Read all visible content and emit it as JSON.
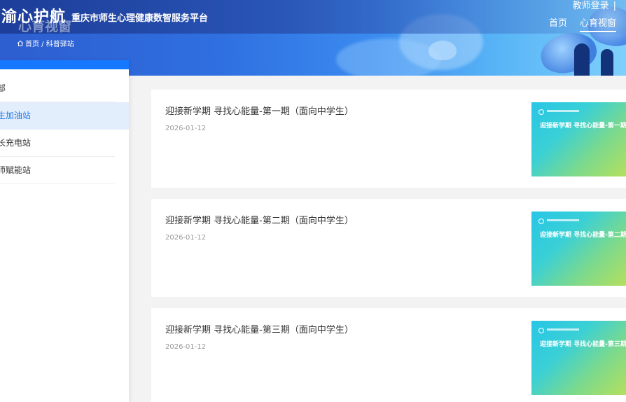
{
  "header": {
    "logo_title": "渝心护航",
    "logo_subtitle": "重庆市师生心理健康数智服务平台",
    "section_ghost_title": "心育视窗",
    "teacher_login": "教师登录",
    "teacher_login_sep": "|",
    "nav": [
      {
        "label": "首页",
        "active": false
      },
      {
        "label": "心育视窗",
        "active": true
      }
    ],
    "breadcrumb": "首页 / 科普驿站"
  },
  "sidebar": {
    "items": [
      {
        "label": "部",
        "active": false
      },
      {
        "label": "生加油站",
        "active": true
      },
      {
        "label": "长充电站",
        "active": false
      },
      {
        "label": "师赋能站",
        "active": false
      }
    ]
  },
  "articles": [
    {
      "title": "迎接新学期 寻找心能量-第一期（面向中学生）",
      "date": "2026-01-12",
      "thumb_title": "迎接新学期 寻找心能量-第一期（面向中学生）"
    },
    {
      "title": "迎接新学期 寻找心能量-第二期（面向中学生）",
      "date": "2026-01-12",
      "thumb_title": "迎接新学期 寻找心能量-第二期（面向中学生）"
    },
    {
      "title": "迎接新学期 寻找心能量-第三期（面向中学生）",
      "date": "2026-01-12",
      "thumb_title": "迎接新学期 寻找心能量-第三期（面向中学生）"
    }
  ],
  "colors": {
    "accent": "#1677ff",
    "active_bg": "#e3eefc",
    "active_text": "#1a73e8"
  }
}
